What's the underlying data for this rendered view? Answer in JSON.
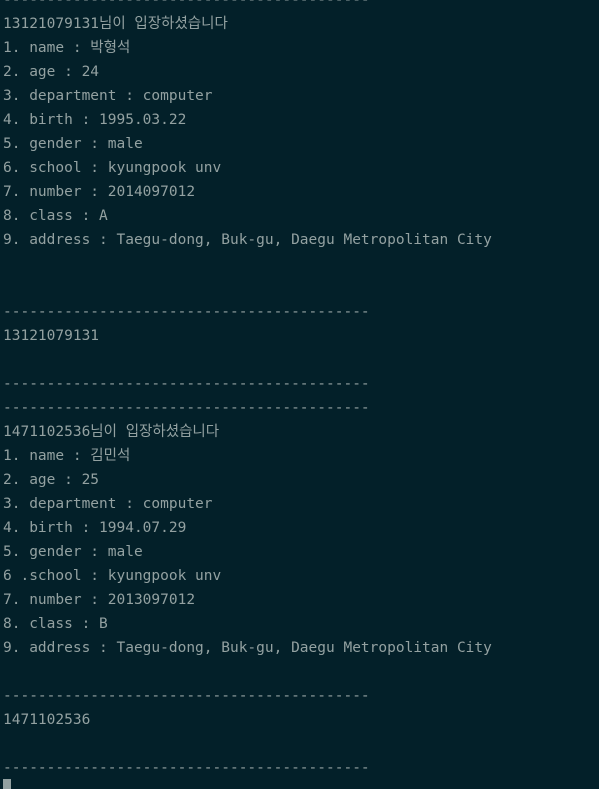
{
  "lines": [
    "------------------------------------------",
    "13121079131님이 입장하셨습니다",
    "1. name : 박형석",
    "2. age : 24",
    "3. department : computer",
    "4. birth : 1995.03.22",
    "5. gender : male",
    "6. school : kyungpook unv",
    "7. number : 2014097012",
    "8. class : A",
    "9. address : Taegu-dong, Buk-gu, Daegu Metropolitan City",
    "------------------------------------------",
    "13121079131",
    "------------------------------------------",
    "------------------------------------------",
    "1471102536님이 입장하셨습니다",
    "1. name : 김민석",
    "2. age : 25",
    "3. department : computer",
    "4. birth : 1994.07.29",
    "5. gender : male",
    "6 .school : kyungpook unv",
    "7. number : 2013097012",
    "8. class : B",
    "9. address : Taegu-dong, Buk-gu, Daegu Metropolitan City",
    "------------------------------------------",
    "1471102536",
    "------------------------------------------"
  ]
}
